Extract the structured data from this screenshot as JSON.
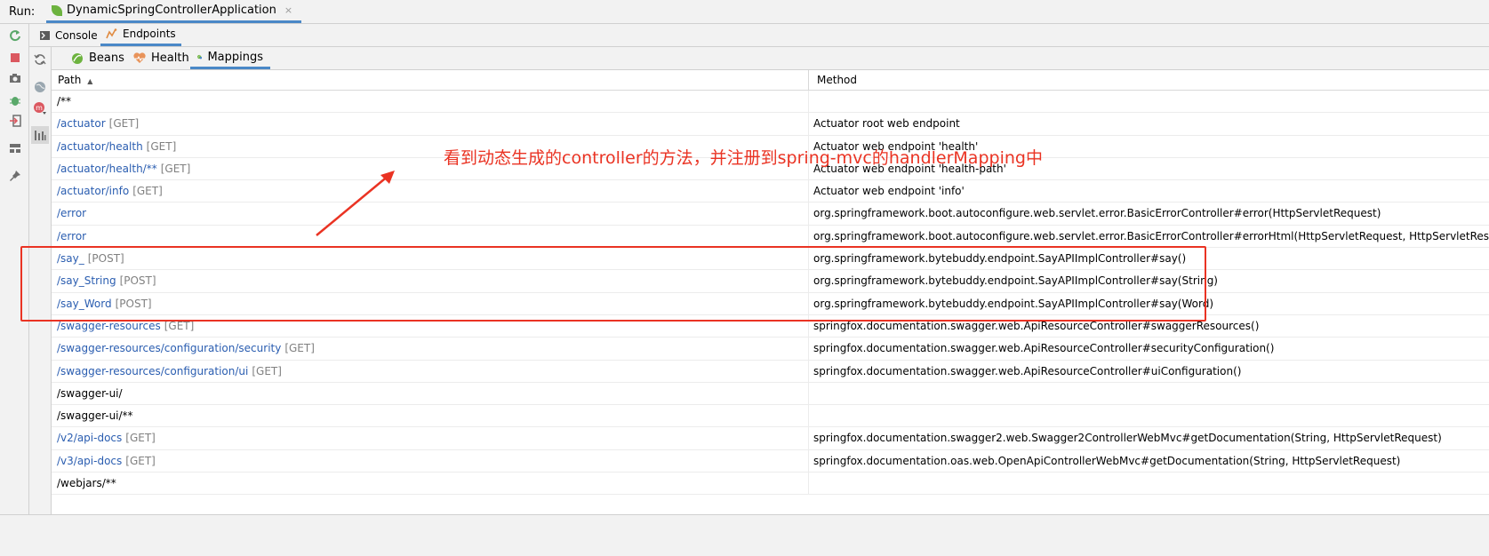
{
  "run_bar": {
    "label": "Run:",
    "tab_title": "DynamicSpringControllerApplication",
    "close_glyph": "×"
  },
  "tool_tabs": [
    {
      "label": "Console",
      "icon": "console-icon"
    },
    {
      "label": "Endpoints",
      "icon": "endpoints-icon",
      "active": true
    }
  ],
  "endpoint_tabs": [
    {
      "label": "Beans",
      "icon": "beans-icon"
    },
    {
      "label": "Health",
      "icon": "health-icon"
    },
    {
      "label": "Mappings",
      "icon": "mappings-icon",
      "active": true
    }
  ],
  "table": {
    "headers": {
      "path": "Path",
      "method": "Method",
      "sort": "▲"
    },
    "rows": [
      {
        "path": "/**",
        "verb": "",
        "method": "",
        "style": "plain"
      },
      {
        "path": "/actuator",
        "verb": "[GET]",
        "method": "Actuator root web endpoint",
        "style": "link"
      },
      {
        "path": "/actuator/health",
        "verb": "[GET]",
        "method": "Actuator web endpoint 'health'",
        "style": "link"
      },
      {
        "path": "/actuator/health/**",
        "verb": "[GET]",
        "method": "Actuator web endpoint 'health-path'",
        "style": "link"
      },
      {
        "path": "/actuator/info",
        "verb": "[GET]",
        "method": "Actuator web endpoint 'info'",
        "style": "link"
      },
      {
        "path": "/error",
        "verb": "",
        "method": "org.springframework.boot.autoconfigure.web.servlet.error.BasicErrorController#error(HttpServletRequest)",
        "style": "link"
      },
      {
        "path": "/error",
        "verb": "",
        "method": "org.springframework.boot.autoconfigure.web.servlet.error.BasicErrorController#errorHtml(HttpServletRequest, HttpServletResponse)",
        "style": "link"
      },
      {
        "path": "/say_",
        "verb": "[POST]",
        "method": "org.springframework.bytebuddy.endpoint.SayAPIImplController#say()",
        "style": "link"
      },
      {
        "path": "/say_String",
        "verb": "[POST]",
        "method": "org.springframework.bytebuddy.endpoint.SayAPIImplController#say(String)",
        "style": "link"
      },
      {
        "path": "/say_Word",
        "verb": "[POST]",
        "method": "org.springframework.bytebuddy.endpoint.SayAPIImplController#say(Word)",
        "style": "link"
      },
      {
        "path": "/swagger-resources",
        "verb": "[GET]",
        "method": "springfox.documentation.swagger.web.ApiResourceController#swaggerResources()",
        "style": "link"
      },
      {
        "path": "/swagger-resources/configuration/security",
        "verb": "[GET]",
        "method": "springfox.documentation.swagger.web.ApiResourceController#securityConfiguration()",
        "style": "link"
      },
      {
        "path": "/swagger-resources/configuration/ui",
        "verb": "[GET]",
        "method": "springfox.documentation.swagger.web.ApiResourceController#uiConfiguration()",
        "style": "link"
      },
      {
        "path": "/swagger-ui/",
        "verb": "",
        "method": "",
        "style": "plain"
      },
      {
        "path": "/swagger-ui/**",
        "verb": "",
        "method": "",
        "style": "plain"
      },
      {
        "path": "/v2/api-docs",
        "verb": "[GET]",
        "method": "springfox.documentation.swagger2.web.Swagger2ControllerWebMvc#getDocumentation(String, HttpServletRequest)",
        "style": "link"
      },
      {
        "path": "/v3/api-docs",
        "verb": "[GET]",
        "method": "springfox.documentation.oas.web.OpenApiControllerWebMvc#getDocumentation(String, HttpServletRequest)",
        "style": "link"
      },
      {
        "path": "/webjars/**",
        "verb": "",
        "method": "",
        "style": "plain"
      }
    ]
  },
  "annotation": {
    "text": "看到动态生成的controller的方法，并注册到spring-mvc的handlerMapping中",
    "color": "#ea3323"
  },
  "colors": {
    "link": "#2a5db0",
    "verb": "#808080",
    "accent": "#4a88c7",
    "spring_green": "#6db33f"
  }
}
